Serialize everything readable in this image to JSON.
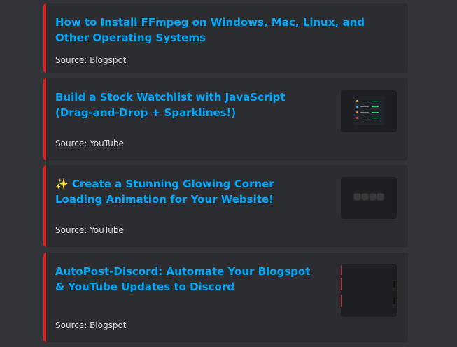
{
  "embeds": [
    {
      "title": "How to Install FFmpeg on Windows, Mac, Linux, and Other Operating Systems",
      "source": "Source: Blogspot",
      "has_thumbnail": false
    },
    {
      "title": "Build a Stock Watchlist with JavaScript (Drag-and-Drop + Sparklines!)",
      "source": "Source: YouTube",
      "has_thumbnail": true,
      "thumbnail_icon": "stock-watchlist-thumbnail"
    },
    {
      "title": "✨ Create a Stunning Glowing Corner Loading Animation for Your Website!",
      "source": "Source: YouTube",
      "has_thumbnail": true,
      "thumbnail_icon": "loading-animation-thumbnail"
    },
    {
      "title": "AutoPost-Discord: Automate Your Blogspot & YouTube Updates to Discord",
      "source": "Source: Blogspot",
      "has_thumbnail": true,
      "thumbnail_icon": "discord-preview-thumbnail"
    }
  ],
  "colors": {
    "accent_bar": "#e01b1b",
    "link": "#00a8fc",
    "embed_bg": "#2b2d31",
    "page_bg": "#313338"
  }
}
